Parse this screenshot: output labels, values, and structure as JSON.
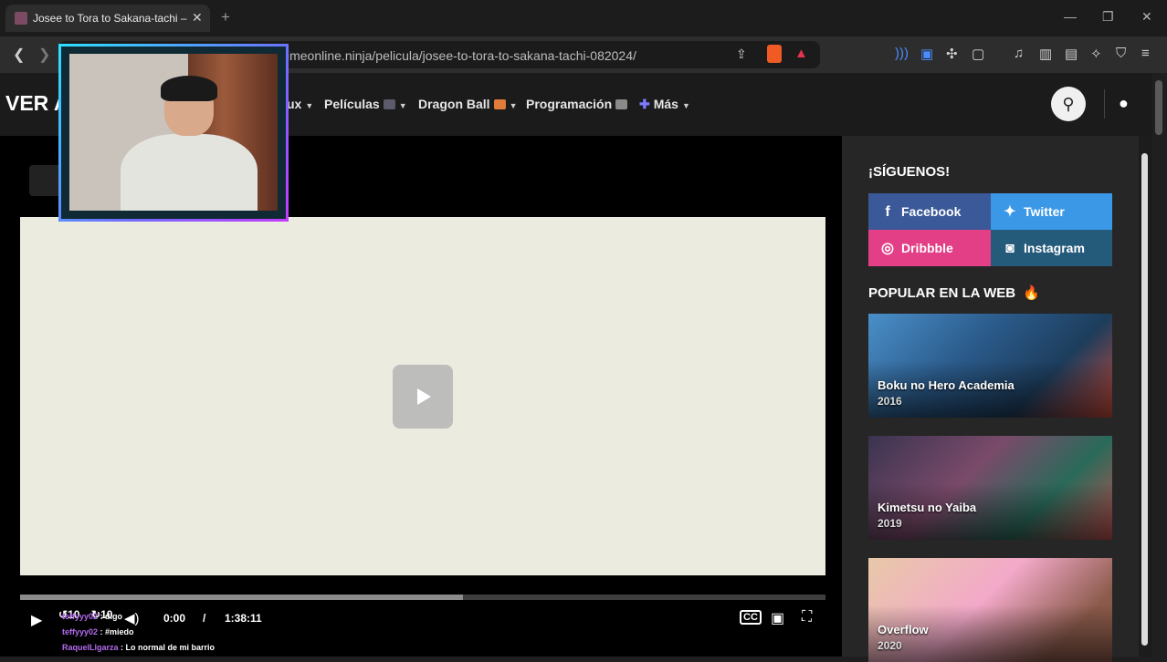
{
  "browser": {
    "tab_title": "Josee to Tora to Sakana-tachi – V",
    "tab_close": "✕",
    "new_tab": "+",
    "url": "imeonline.ninja/pelicula/josee-to-tora-to-sakana-tachi-082024/",
    "window_controls": {
      "minimize": "—",
      "maximize": "❐",
      "close": "✕"
    }
  },
  "site": {
    "logo": "VER A",
    "nav": [
      {
        "label": "ux",
        "badge_color": ""
      },
      {
        "label": "Películas",
        "badge_color": "#5b5b6b"
      },
      {
        "label": "Dragon Ball",
        "badge_color": "#e07b3a"
      },
      {
        "label": "Programación",
        "badge_color": "#8a8a8a"
      },
      {
        "label": "Más",
        "prefix": "✚"
      }
    ]
  },
  "player": {
    "progress": 0.55,
    "time_current": "0:00",
    "time_separator": "/",
    "time_total": "1:38:11",
    "skip_back": "10",
    "skip_forward": "10"
  },
  "chat": [
    {
      "user": "teffyyy02",
      "text": "digo"
    },
    {
      "user": "teffyyy02",
      "text": "#miedo"
    },
    {
      "user": "RaquelLlgarza",
      "text": "Lo normal de mi barrio"
    }
  ],
  "sidebar": {
    "follow_heading": "¡SÍGUENOS!",
    "social": [
      {
        "label": "Facebook",
        "color": "#3b5998"
      },
      {
        "label": "Twitter",
        "color": "#3b98e6"
      },
      {
        "label": "Dribbble",
        "color": "#e23f86"
      },
      {
        "label": "Instagram",
        "color": "#245a7a"
      }
    ],
    "popular_heading": "POPULAR EN LA WEB",
    "popular": [
      {
        "title": "Boku no Hero Academia",
        "year": "2016"
      },
      {
        "title": "Kimetsu no Yaiba",
        "year": "2019"
      },
      {
        "title": "Overflow",
        "year": "2020"
      }
    ]
  }
}
